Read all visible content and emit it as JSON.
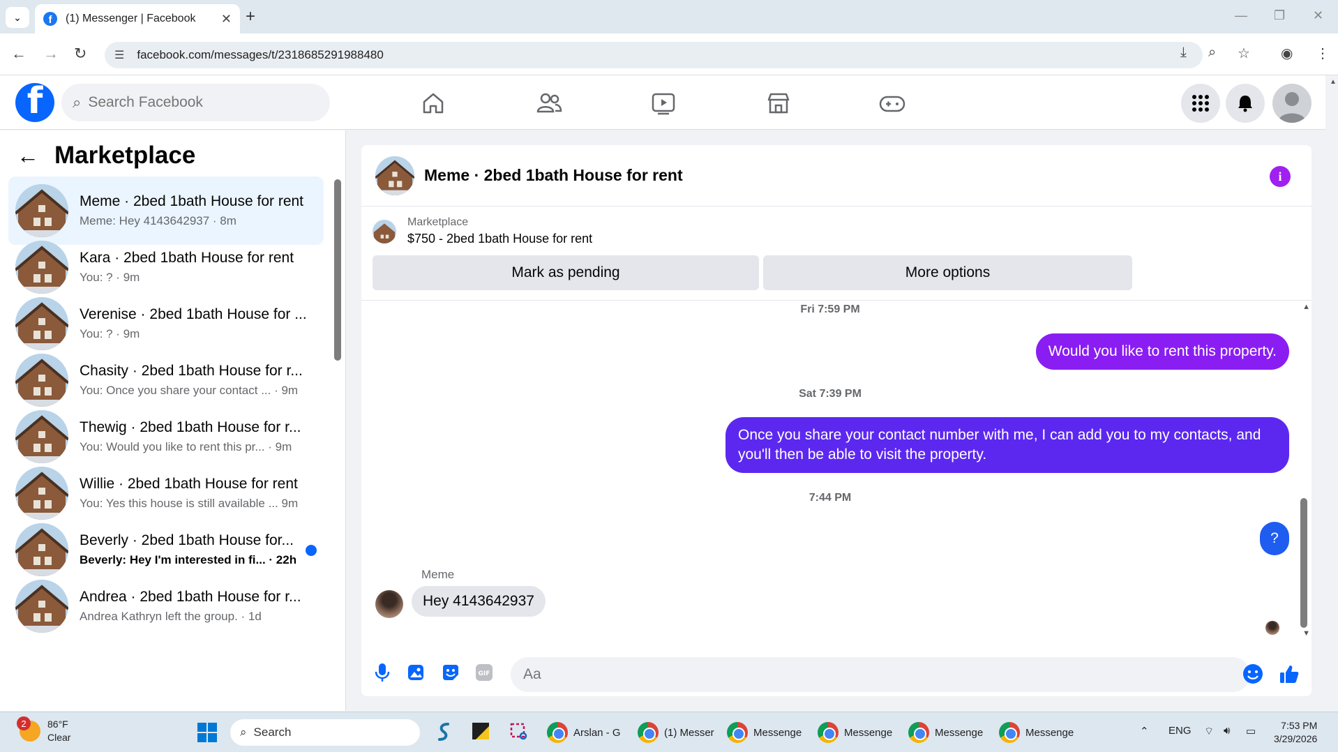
{
  "browser": {
    "tab_title": "(1) Messenger | Facebook",
    "url": "facebook.com/messages/t/2318685291988480"
  },
  "fb": {
    "search_placeholder": "Search Facebook"
  },
  "left_panel": {
    "title": "Marketplace",
    "conversations": [
      {
        "name": "Meme · 2bed 1bath House for rent",
        "snippet": "Meme: Hey 4143642937 · 8m",
        "active": true,
        "unread": false
      },
      {
        "name": "Kara · 2bed 1bath House for rent",
        "snippet": "You: ? · 9m",
        "active": false,
        "unread": false
      },
      {
        "name": "Verenise · 2bed 1bath House for ...",
        "snippet": "You: ? · 9m",
        "active": false,
        "unread": false
      },
      {
        "name": "Chasity · 2bed 1bath House for r...",
        "snippet": "You: Once you share your contact ... · 9m",
        "active": false,
        "unread": false
      },
      {
        "name": "Thewig · 2bed 1bath House for r...",
        "snippet": "You: Would you like to rent this pr... · 9m",
        "active": false,
        "unread": false
      },
      {
        "name": "Willie · 2bed 1bath House for rent",
        "snippet": "You: Yes this house is still available ... 9m",
        "active": false,
        "unread": false
      },
      {
        "name": "Beverly · 2bed 1bath House for...",
        "snippet": "Beverly: Hey I'm interested in fi... · 22h",
        "active": false,
        "unread": true
      },
      {
        "name": "Andrea · 2bed 1bath House for r...",
        "snippet": "Andrea Kathryn left the group. · 1d",
        "active": false,
        "unread": false
      }
    ]
  },
  "chat": {
    "title": "Meme · 2bed 1bath House for rent",
    "listing_category": "Marketplace",
    "listing_desc": "$750 - 2bed 1bath House for rent",
    "mark_pending_label": "Mark as pending",
    "more_options_label": "More options",
    "messages": [
      {
        "type": "time",
        "text": "Fri 7:59 PM"
      },
      {
        "type": "out",
        "text": "Would you like to rent this property."
      },
      {
        "type": "time",
        "text": "Sat 7:39 PM"
      },
      {
        "type": "out",
        "text": "Once you share your contact number with me, I can add you to my contacts, and you'll then be able to visit the property."
      },
      {
        "type": "time",
        "text": "7:44 PM"
      },
      {
        "type": "out",
        "text": "?"
      },
      {
        "type": "in",
        "sender": "Meme",
        "text": "Hey 4143642937"
      }
    ],
    "composer_placeholder": "Aa"
  },
  "taskbar": {
    "weather_badge": "2",
    "temp": "86°F",
    "condition": "Clear",
    "search": "Search",
    "apps": [
      "Arslan - G",
      "(1) Messer",
      "Messenge",
      "Messenge",
      "Messenge",
      "Messenge"
    ],
    "lang": "ENG",
    "time": "7:53 PM",
    "date": "3/29/2026"
  },
  "colors": {
    "fb_blue": "#0866ff",
    "bubble_violet": "#8a1df2",
    "bubble_indigo": "#5c28f0",
    "bubble_blue": "#1f5cf0"
  }
}
